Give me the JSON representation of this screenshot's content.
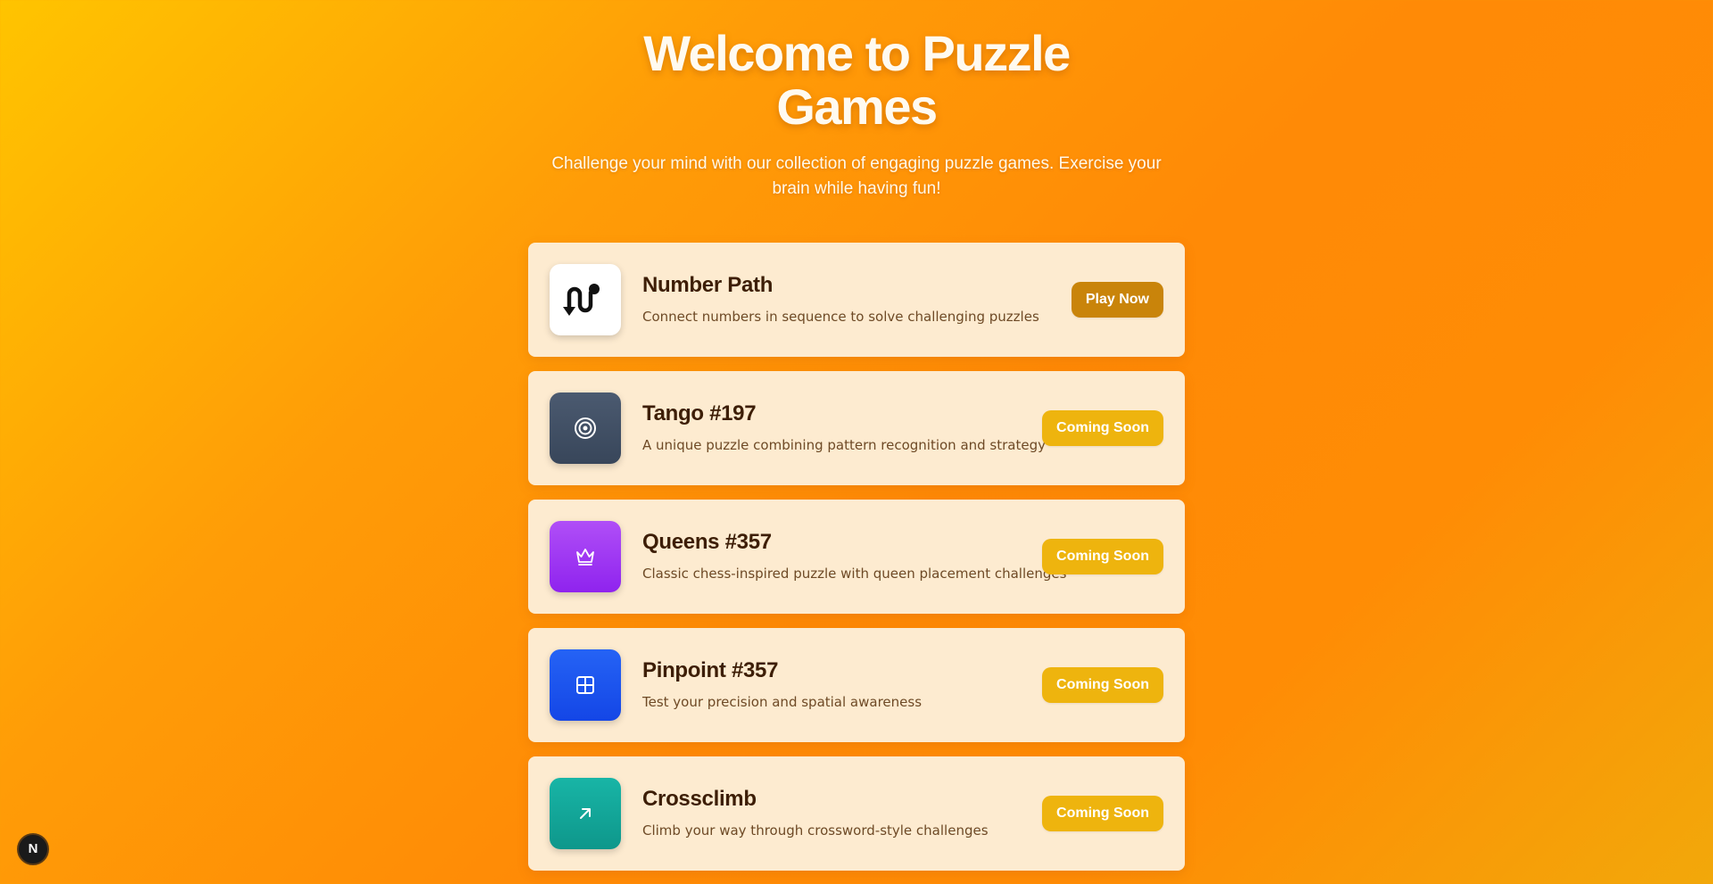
{
  "hero": {
    "title": "Welcome to Puzzle Games",
    "subtitle": "Challenge your mind with our collection of engaging puzzle games. Exercise your brain while having fun!"
  },
  "games": [
    {
      "name": "Number Path",
      "description": "Connect numbers in sequence to solve challenging puzzles",
      "button_label": "Play Now",
      "icon": "number-path-icon",
      "icon_color": "#ffffff"
    },
    {
      "name": "Tango #197",
      "description": "A unique puzzle combining pattern recognition and strategy",
      "button_label": "Coming Soon",
      "icon": "target-icon",
      "icon_color": "#445266"
    },
    {
      "name": "Queens #357",
      "description": "Classic chess-inspired puzzle with queen placement challenges",
      "button_label": "Coming Soon",
      "icon": "crown-icon",
      "icon_color": "#a23ef5"
    },
    {
      "name": "Pinpoint #357",
      "description": "Test your precision and spatial awareness",
      "button_label": "Coming Soon",
      "icon": "grid-icon",
      "icon_color": "#1e55ef"
    },
    {
      "name": "Crossclimb",
      "description": "Climb your way through crossword-style challenges",
      "button_label": "Coming Soon",
      "icon": "arrow-up-right-icon",
      "icon_color": "#14a79b"
    }
  ],
  "badge": {
    "label": "N"
  },
  "colors": {
    "play_button": "#c9840a",
    "coming_soon_button": "#eeb40e",
    "card_background": "#fdebd0"
  }
}
